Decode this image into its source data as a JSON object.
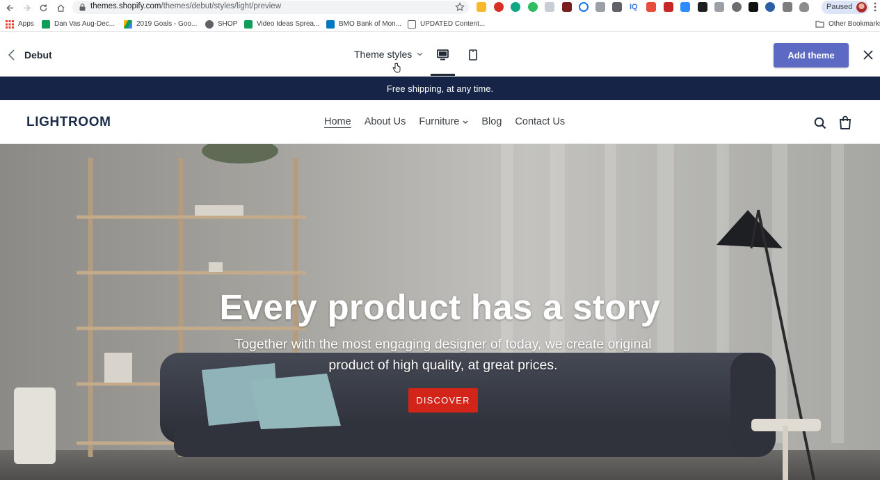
{
  "browser": {
    "url_domain": "themes.shopify.com",
    "url_path": "/themes/debut/styles/light/preview",
    "profile_label": "Paused",
    "bookmarks": [
      {
        "label": "Apps",
        "icon": "apps-grid-icon",
        "color": "#e94235"
      },
      {
        "label": "Dan Vas Aug-Dec...",
        "icon": "sheets-icon",
        "color": "#0f9d58"
      },
      {
        "label": "2019 Goals - Goo...",
        "icon": "drive-icon",
        "color": "#f4b400"
      },
      {
        "label": "SHOP",
        "icon": "globe-icon",
        "color": "#5f6368"
      },
      {
        "label": "Video Ideas Sprea...",
        "icon": "sheets-icon",
        "color": "#0f9d58"
      },
      {
        "label": "BMO Bank of Mon...",
        "icon": "bmo-icon",
        "color": "#0079c1"
      },
      {
        "label": "UPDATED Content...",
        "icon": "doc-icon",
        "color": "#5f6368"
      }
    ],
    "other_bookmarks": "Other Bookmarks"
  },
  "preview_bar": {
    "theme_name": "Debut",
    "styles_label": "Theme styles",
    "add_theme_label": "Add theme"
  },
  "store": {
    "announcement": "Free shipping, at any time.",
    "logo": "LIGHTROOM",
    "nav": [
      "Home",
      "About Us",
      "Furniture",
      "Blog",
      "Contact Us"
    ],
    "hero": {
      "title": "Every product has a story",
      "subtitle": "Together with the most engaging designer of today, we create original product of high quality, at great prices.",
      "cta": "DISCOVER"
    }
  },
  "colors": {
    "announcement_bg": "#152447",
    "add_theme_bg": "#5c6ac4",
    "cta_bg": "#d3241a"
  }
}
